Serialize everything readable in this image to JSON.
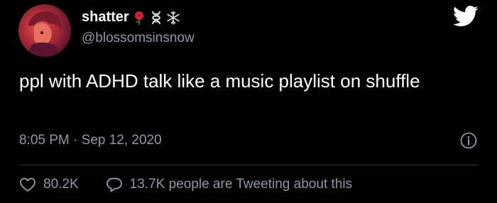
{
  "tweet": {
    "display_name": "shatter",
    "name_emojis": [
      "rose-emoji",
      "dna-emoji",
      "snowflake-emoji"
    ],
    "handle": "@blossomsinsnow",
    "text": "ppl with ADHD talk like a music playlist on shuffle",
    "timestamp": "8:05 PM · Sep 12, 2020",
    "like_count": "80.2K",
    "reply_summary": "13.7K people are Tweeting about this"
  },
  "colors": {
    "background": "#000000",
    "primary_text": "#ffffff",
    "secondary_text": "#8b98a5",
    "divider": "#2f3336",
    "rose": "#d0243a"
  },
  "icons": {
    "brand": "twitter-bird-icon",
    "info": "info-icon",
    "like": "heart-icon",
    "reply": "speech-bubble-icon"
  }
}
